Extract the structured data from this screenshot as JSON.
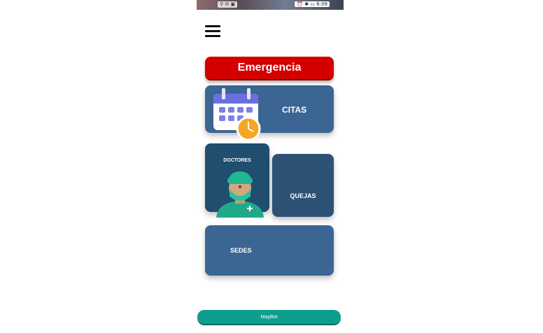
{
  "status_bar": {
    "time": "6:09"
  },
  "menu": {
    "icon": "hamburger-menu-icon"
  },
  "buttons": {
    "emergency_label": "Emergencia",
    "maybot_label": "MayBot"
  },
  "cards": {
    "citas": {
      "label": "CITAS",
      "icon": "calendar-clock-icon"
    },
    "doctores": {
      "label": "DOCTORES",
      "icon": "doctor-icon"
    },
    "quejas": {
      "label": "QUEJAS",
      "icon": "question-bubble-icon"
    },
    "sedes": {
      "label": "SEDES",
      "icon": "hospital-building-icon"
    }
  },
  "colors": {
    "emergency": "#d40000",
    "card_blue": "#3b6694",
    "card_dark": "#1f4e6e",
    "maybot": "#0f9e8e"
  }
}
